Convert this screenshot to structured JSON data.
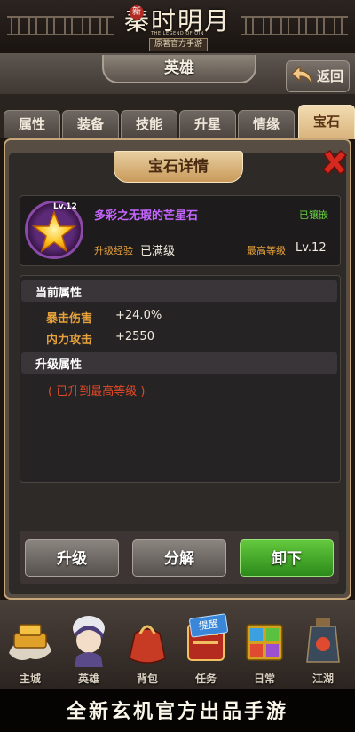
{
  "logo": {
    "new_badge": "新",
    "title": "秦时明月",
    "subtitle_en": "THE LEGEND OF QIN",
    "subtitle": "原著官方手游"
  },
  "header": {
    "title": "英雄",
    "back_label": "返回"
  },
  "tabs": [
    {
      "label": "属性",
      "active": false
    },
    {
      "label": "装备",
      "active": false
    },
    {
      "label": "技能",
      "active": false
    },
    {
      "label": "升星",
      "active": false
    },
    {
      "label": "情缘",
      "active": false
    },
    {
      "label": "宝石",
      "active": true
    }
  ],
  "panel": {
    "title": "宝石详情"
  },
  "gem": {
    "level": "Lv.12",
    "name": "多彩之无瑕的芒星石",
    "status": "已镶嵌",
    "xp_label": "升级经验",
    "xp_value": "已满级",
    "max_label": "最高等级",
    "max_value": "Lv.12"
  },
  "current_attrs": {
    "title": "当前属性",
    "items": [
      {
        "name": "暴击伤害",
        "value": "+24.0%"
      },
      {
        "name": "内力攻击",
        "value": "+2550"
      }
    ]
  },
  "upgrade_attrs": {
    "title": "升级属性",
    "note": "( 已升到最高等级 )"
  },
  "buttons": {
    "upgrade": "升级",
    "decompose": "分解",
    "unequip": "卸下"
  },
  "nav": {
    "items": [
      {
        "label": "主城",
        "icon": "main-city-icon"
      },
      {
        "label": "英雄",
        "icon": "hero-icon"
      },
      {
        "label": "背包",
        "icon": "bag-icon"
      },
      {
        "label": "任务",
        "icon": "task-icon"
      },
      {
        "label": "日常",
        "icon": "daily-icon"
      },
      {
        "label": "江湖",
        "icon": "jianghu-icon"
      }
    ],
    "badge": "提醒"
  },
  "footer": "全新玄机官方出品手游",
  "colors": {
    "accent": "#d9b27a",
    "gem_name": "#c566ff",
    "status_green": "#65d241",
    "label_orange": "#e5a13a",
    "warn_red": "#e04a26",
    "button_green": "#2c8a1a"
  }
}
